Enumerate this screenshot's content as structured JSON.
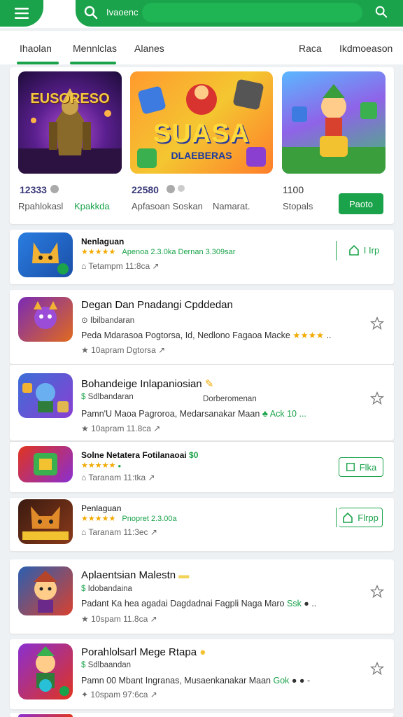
{
  "header": {
    "search_text": "Ivaoenc",
    "menu_icon": "menu-icon",
    "search_icon": "search-icon"
  },
  "tabs": [
    {
      "label": "Ihaolan",
      "active": true
    },
    {
      "label": "Mennlclas",
      "active": true
    },
    {
      "label": "Alanes",
      "active": false
    },
    {
      "label": "Raca",
      "active": false
    },
    {
      "label": "Ikdmoeason",
      "active": false
    }
  ],
  "featured": {
    "items": [
      {
        "number": "12333",
        "subtitle": "Rpahlokasl",
        "subtitle2": "Kpakkda",
        "art_text": "EUSORESO"
      },
      {
        "number": "22580",
        "subtitle": "Apfasoan Soskan",
        "art_text": "SUASA",
        "art_text2": "DLAEBERAS"
      },
      {
        "number": "1100",
        "subtitle": "Stopals"
      }
    ],
    "mid_caption": "Namarat.",
    "play_label": "Paoto"
  },
  "list": [
    {
      "title": "Nenlaguan",
      "stars": "★★★★★",
      "stars_text": "Apenoa 2.3.0ka  Dernan 3.309sar",
      "meta": "Tetampm  11:8ca",
      "button": "I Irp"
    },
    {
      "title": "Degan Dan Pnadangi Cpddedan",
      "sub": "Ibilbandaran",
      "desc": "Peda Mdarasoa Pogtorsa, Id, Nedlono Fagaoa Macke",
      "desc_stars": "★★★★",
      "meta": "10apram  Dgtorsa"
    },
    {
      "title": "Bohandeige Inlapaniosian",
      "sub": "Sdlbandaran",
      "sub2": "Dorberomenan",
      "desc": "Pamn'U Maoa Pagroroa, Medarsanakar Maan",
      "desc_tail": "Ack  10 ...",
      "meta": "10apram  11.8ca"
    },
    {
      "title": "Solne Netatera Fotilanaoai",
      "badge": "$0",
      "stars": "★★★★★",
      "meta": "Taranam  11:tka",
      "button": "Flka"
    },
    {
      "title": "Penlaguan",
      "stars": "★★★★★",
      "stars_text": "Pnopret 2.3.00a",
      "meta": "Taranam  11:3ec",
      "button": "Flrpp"
    },
    {
      "title": "Aplaentsian Malestn",
      "sub": "Idobandaina",
      "desc": "Padant Ka hea agadai Dagdadnai Fagpli Naga Maro",
      "desc_tail": "Ssk",
      "meta": "10spam  11.8ca"
    },
    {
      "title": "Porahlolsarl Mege Rtapa",
      "sub": "Sdlbaandan",
      "desc": "Pamn 00 Mbant Ingranas, Musaenkanakar Maan",
      "desc_tail": "Gok",
      "meta": "10spam  97:6ca"
    }
  ],
  "colors": {
    "accent": "#1aa34a",
    "star": "#f2a900"
  }
}
